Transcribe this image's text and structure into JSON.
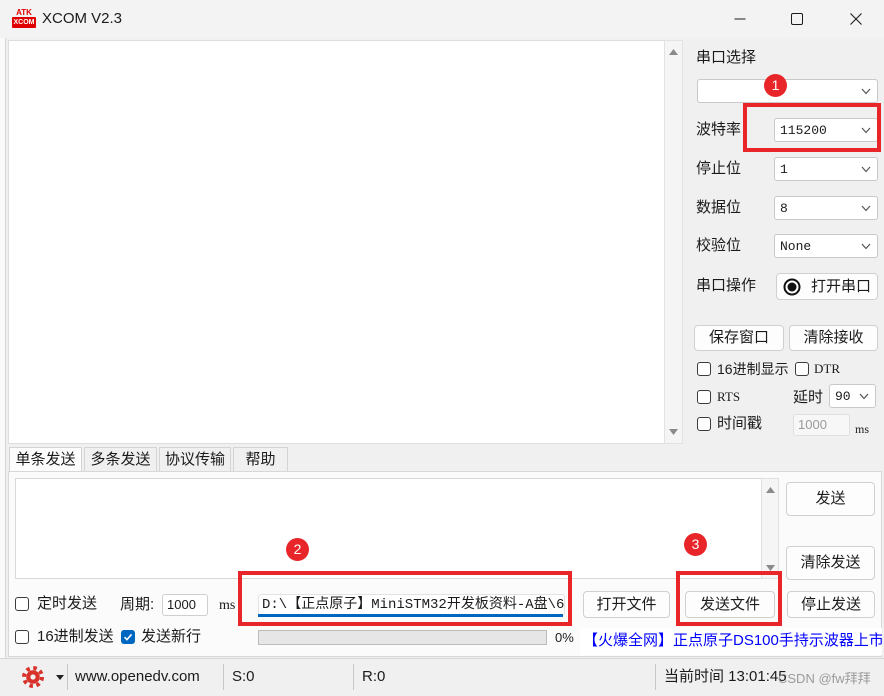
{
  "window": {
    "title": "XCOM V2.3",
    "logo_top": "ATK",
    "logo_bottom": "XCOM"
  },
  "serial": {
    "port_label": "串口选择",
    "baud_label": "波特率",
    "baud_value": "115200",
    "stop_label": "停止位",
    "stop_value": "1",
    "data_label": "数据位",
    "data_value": "8",
    "parity_label": "校验位",
    "parity_value": "None",
    "operation_label": "串口操作",
    "open_button": "打开串口",
    "save_window_button": "保存窗口",
    "clear_receive_button": "清除接收"
  },
  "options": {
    "hex_display": {
      "label": "16进制显示",
      "checked": false
    },
    "dtr": {
      "label": "DTR",
      "checked": false
    },
    "rts": {
      "label": "RTS",
      "checked": false
    },
    "delay_label": "延时",
    "delay_value": "90",
    "timestamp": {
      "label": "时间戳",
      "checked": false
    },
    "timestamp_value": "1000",
    "timestamp_unit": "ms"
  },
  "tabs": [
    {
      "label": "单条发送",
      "active": true
    },
    {
      "label": "多条发送",
      "active": false
    },
    {
      "label": "协议传输",
      "active": false
    },
    {
      "label": "帮助",
      "active": false
    }
  ],
  "send": {
    "send_button": "发送",
    "clear_send_button": "清除发送",
    "timed_send": {
      "label": "定时发送",
      "checked": false
    },
    "period_label": "周期:",
    "period_value": "1000",
    "period_unit": "ms",
    "file_path": "D:\\【正点原子】MiniSTM32开发板资料-A盘\\6",
    "open_file_button": "打开文件",
    "send_file_button": "发送文件",
    "stop_send_button": "停止发送",
    "hex_send": {
      "label": "16进制发送",
      "checked": false
    },
    "send_newline": {
      "label": "发送新行",
      "checked": true
    },
    "progress": 0,
    "progress_text": "0%",
    "ad_link": "【火爆全网】正点原子DS100手持示波器上市"
  },
  "status": {
    "website": "www.openedv.com",
    "sent_count": "S:0",
    "received_count": "R:0",
    "current_time": "当前时间 13:01:45"
  },
  "annotations": {
    "marker_1": "1",
    "marker_2": "2",
    "marker_3": "3"
  },
  "watermark": "CSDN @fw拜拜",
  "colors": {
    "annotation_red": "#e8262a",
    "link_blue": "#0000ff",
    "checkbox_blue": "#0067c0",
    "gear_red": "#d8322a",
    "logo_red": "#e00000"
  },
  "icons": {
    "app_logo": "xcom-logo-icon",
    "minimize": "minimize-icon",
    "maximize": "maximize-icon",
    "close": "close-icon",
    "dropdown": "chevron-down-icon",
    "scroll_up": "scroll-up-icon",
    "scroll_down": "scroll-down-icon",
    "open_port": "radio-dot-icon",
    "settings": "gear-icon",
    "settings_menu": "caret-down-icon",
    "checkmark": "checkmark-icon"
  }
}
